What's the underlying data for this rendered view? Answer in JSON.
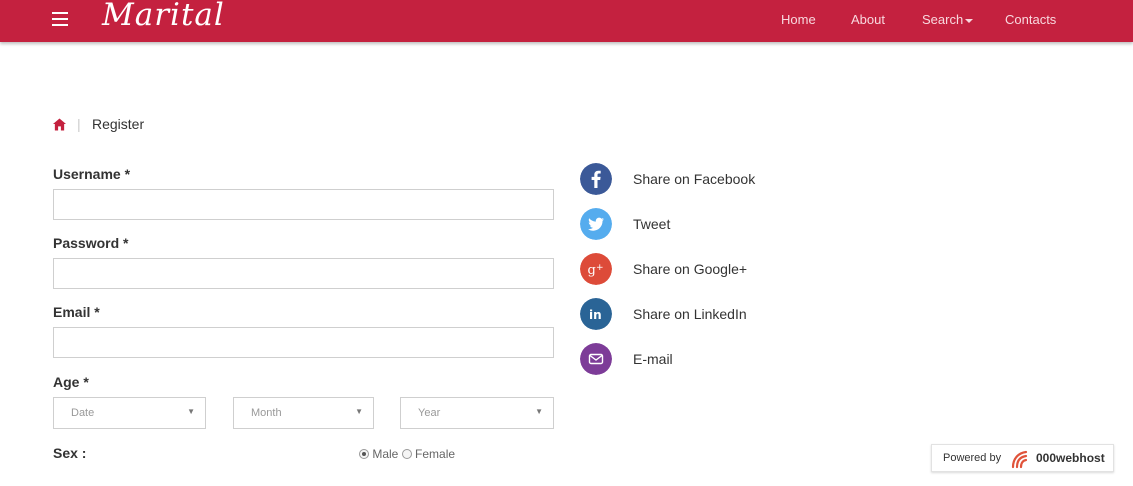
{
  "header": {
    "brand": "Marital",
    "nav": {
      "home": "Home",
      "about": "About",
      "search": "Search",
      "contacts": "Contacts"
    }
  },
  "breadcrumb": {
    "current": "Register"
  },
  "form": {
    "username_label": "Username *",
    "password_label": "Password *",
    "email_label": "Email *",
    "age_label": "Age *",
    "date_placeholder": "Date",
    "month_placeholder": "Month",
    "year_placeholder": "Year",
    "sex_label": "Sex :",
    "male_label": "Male",
    "female_label": "Female",
    "selected_sex": "Male"
  },
  "share": {
    "facebook": "Share on Facebook",
    "twitter": "Tweet",
    "google": "Share on Google+",
    "linkedin": "Share on LinkedIn",
    "email": "E-mail"
  },
  "powered": {
    "text": "Powered by",
    "brand": "000webhost"
  },
  "colors": {
    "header": "#c4213f",
    "facebook": "#3b5998",
    "twitter": "#55acee",
    "google": "#dd4b39",
    "linkedin": "#2a6496",
    "email": "#7d3c98"
  }
}
